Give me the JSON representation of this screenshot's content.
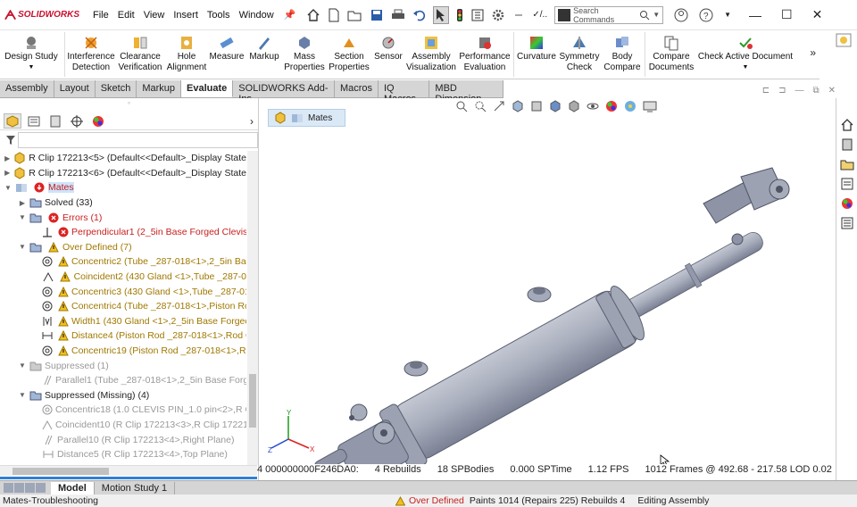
{
  "app": {
    "name": "SOLIDWORKS"
  },
  "menu": [
    "File",
    "Edit",
    "View",
    "Insert",
    "Tools",
    "Window"
  ],
  "search": {
    "placeholder": "Search Commands"
  },
  "command_manager": {
    "tools": [
      {
        "label": "Design Study",
        "icon": "design-study-icon"
      },
      {
        "label": "Interference Detection",
        "icon": "interference-detection-icon"
      },
      {
        "label": "Clearance Verification",
        "icon": "clearance-verification-icon"
      },
      {
        "label": "Hole Alignment",
        "icon": "hole-alignment-icon"
      },
      {
        "label": "Measure",
        "icon": "measure-icon"
      },
      {
        "label": "Markup",
        "icon": "markup-icon"
      },
      {
        "label": "Mass Properties",
        "icon": "mass-properties-icon"
      },
      {
        "label": "Section Properties",
        "icon": "section-properties-icon"
      },
      {
        "label": "Sensor",
        "icon": "sensor-icon"
      },
      {
        "label": "Assembly Visualization",
        "icon": "assembly-visualization-icon"
      },
      {
        "label": "Performance Evaluation",
        "icon": "performance-evaluation-icon"
      },
      {
        "label": "Curvature",
        "icon": "curvature-icon"
      },
      {
        "label": "Symmetry Check",
        "icon": "symmetry-check-icon"
      },
      {
        "label": "Body Compare",
        "icon": "body-compare-icon"
      },
      {
        "label": "Compare Documents",
        "icon": "compare-documents-icon"
      },
      {
        "label": "Check Active Document",
        "icon": "check-active-document-icon"
      }
    ]
  },
  "tabs": [
    "Assembly",
    "Layout",
    "Sketch",
    "Markup",
    "Evaluate",
    "SOLIDWORKS Add-Ins",
    "Macros",
    "IQ Macros",
    "MBD Dimension"
  ],
  "active_tab": "Evaluate",
  "tree": [
    {
      "label": "R Clip 172213<5> (Default<<Default>_Display State",
      "state": "normal",
      "indent": 0,
      "expander": "▶"
    },
    {
      "label": "R Clip 172213<6> (Default<<Default>_Display State",
      "state": "normal",
      "indent": 0,
      "expander": "▶"
    },
    {
      "label": "Mates",
      "state": "err",
      "indent": 0,
      "expander": "▼"
    },
    {
      "label": "Solved (33)",
      "state": "normal",
      "indent": 1,
      "expander": "▶"
    },
    {
      "label": "Errors (1)",
      "state": "err",
      "indent": 1,
      "expander": "▼"
    },
    {
      "label": "Perpendicular1 (2_5in Base Forged Clevis",
      "state": "err",
      "indent": 2,
      "expander": ""
    },
    {
      "label": "Over Defined (7)",
      "state": "warn",
      "indent": 1,
      "expander": "▼"
    },
    {
      "label": "Concentric2 (Tube _287-018<1>,2_5in Bas",
      "state": "warn",
      "indent": 2,
      "expander": ""
    },
    {
      "label": "Coincident2 (430 Gland <1>,Tube _287-0",
      "state": "warn",
      "indent": 2,
      "expander": ""
    },
    {
      "label": "Concentric3 (430 Gland <1>,Tube _287-01",
      "state": "warn",
      "indent": 2,
      "expander": ""
    },
    {
      "label": "Concentric4 (Tube _287-018<1>,Piston Ro",
      "state": "warn",
      "indent": 2,
      "expander": ""
    },
    {
      "label": "Width1 (430 Gland <1>,2_5in Base Forgec",
      "state": "warn",
      "indent": 2,
      "expander": ""
    },
    {
      "label": "Distance4 (Piston Rod _287-018<1>,Rod C",
      "state": "warn",
      "indent": 2,
      "expander": ""
    },
    {
      "label": "Concentric19 (Piston Rod _287-018<1>,Ro",
      "state": "warn",
      "indent": 2,
      "expander": ""
    },
    {
      "label": "Suppressed (1)",
      "state": "gray",
      "indent": 1,
      "expander": "▼"
    },
    {
      "label": "Parallel1 (Tube _287-018<1>,2_5in Base Forg",
      "state": "gray",
      "indent": 2,
      "expander": ""
    },
    {
      "label": "Suppressed (Missing) (4)",
      "state": "normal",
      "indent": 1,
      "expander": "▼"
    },
    {
      "label": "Concentric18 (1.0 CLEVIS PIN_1.0 pin<2>,R Cl",
      "state": "gray",
      "indent": 2,
      "expander": ""
    },
    {
      "label": "Coincident10 (R Clip 172213<3>,R Clip 172213",
      "state": "gray",
      "indent": 2,
      "expander": ""
    },
    {
      "label": "Parallel10 (R Clip 172213<4>,Right Plane)",
      "state": "gray",
      "indent": 2,
      "expander": ""
    },
    {
      "label": "Distance5 (R Clip 172213<4>,Top Plane)",
      "state": "gray",
      "indent": 2,
      "expander": ""
    }
  ],
  "breadcrumb": "Mates",
  "stats": [
    "4 000000000F246DA0:",
    "4 Rebuilds",
    "18 SPBodies",
    "0.000 SPTime",
    "1.12 FPS",
    "1012 Frames @ 492.68 - 217.58 LOD 0.02"
  ],
  "bottom_tabs": [
    "Model",
    "Motion Study 1"
  ],
  "status": {
    "left": "Mates-Troubleshooting",
    "warning": "Over Defined",
    "items": [
      "Paints 1014 (Repairs 225) Rebuilds 4",
      "Editing Assembly"
    ]
  }
}
